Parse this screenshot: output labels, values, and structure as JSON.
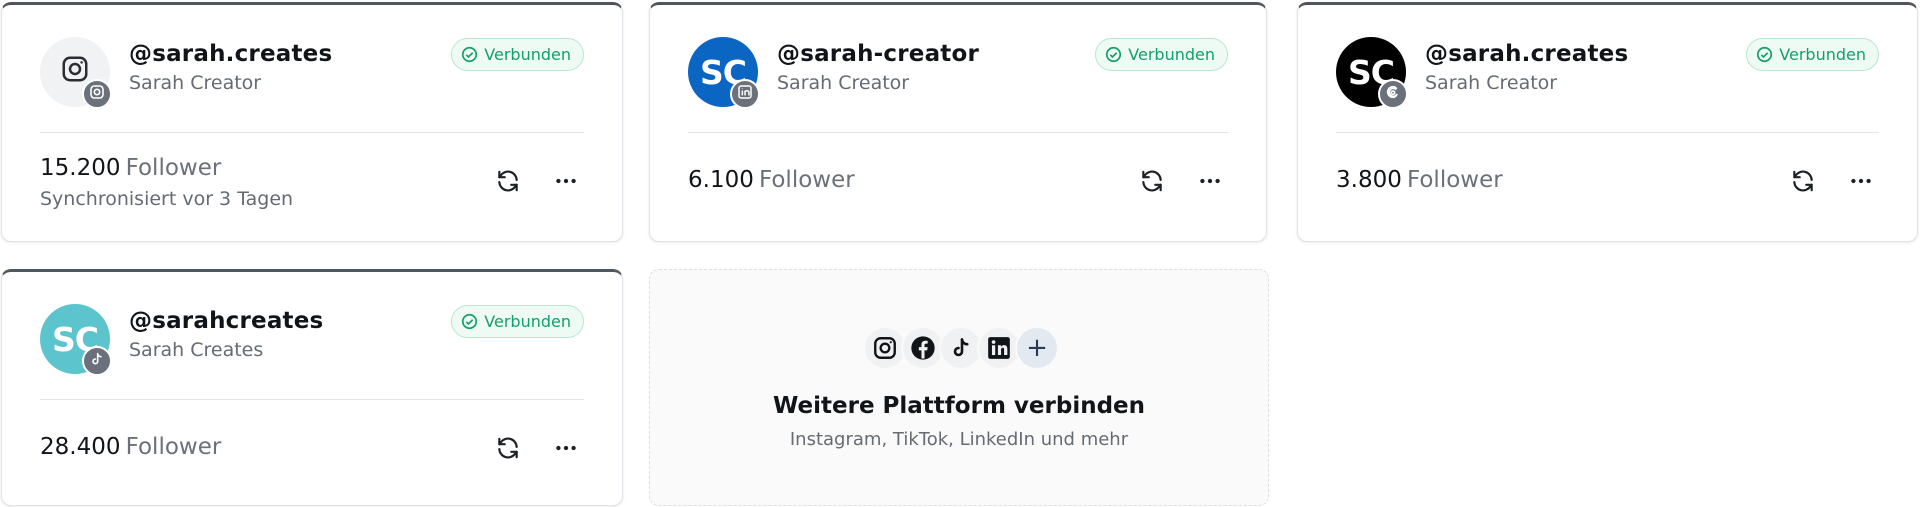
{
  "colors": {
    "status_green": "#14a06a",
    "linkedin_blue": "#0a66c2",
    "tiktok_teal": "#5cc4cc",
    "threads_black": "#000000",
    "card_top_border": "#50565e"
  },
  "accounts": [
    {
      "platform": "Instagram",
      "avatar_icon": "instagram-icon",
      "badge_icon": "instagram-icon",
      "handle": "@sarah.creates",
      "name": "Sarah Creator",
      "status": "Verbunden",
      "followers": "15.200",
      "followers_label": "Follower",
      "sync_text": "Synchronisiert vor 3 Tagen"
    },
    {
      "platform": "LinkedIn",
      "avatar_initials": "SC",
      "badge_icon": "linkedin-icon",
      "handle": "@sarah-creator",
      "name": "Sarah Creator",
      "status": "Verbunden",
      "followers": "6.100",
      "followers_label": "Follower"
    },
    {
      "platform": "Threads",
      "avatar_initials": "SC",
      "badge_icon": "threads-icon",
      "handle": "@sarah.creates",
      "name": "Sarah Creator",
      "status": "Verbunden",
      "followers": "3.800",
      "followers_label": "Follower"
    },
    {
      "platform": "TikTok",
      "avatar_initials": "SC",
      "badge_icon": "tiktok-icon",
      "handle": "@sarahcreates",
      "name": "Sarah Creates",
      "status": "Verbunden",
      "followers": "28.400",
      "followers_label": "Follower"
    }
  ],
  "add_platform": {
    "icons": [
      "instagram-icon",
      "facebook-icon",
      "tiktok-icon",
      "linkedin-icon",
      "plus-icon"
    ],
    "plus_glyph": "+",
    "title": "Weitere Plattform verbinden",
    "subtitle": "Instagram, TikTok, LinkedIn und mehr"
  }
}
